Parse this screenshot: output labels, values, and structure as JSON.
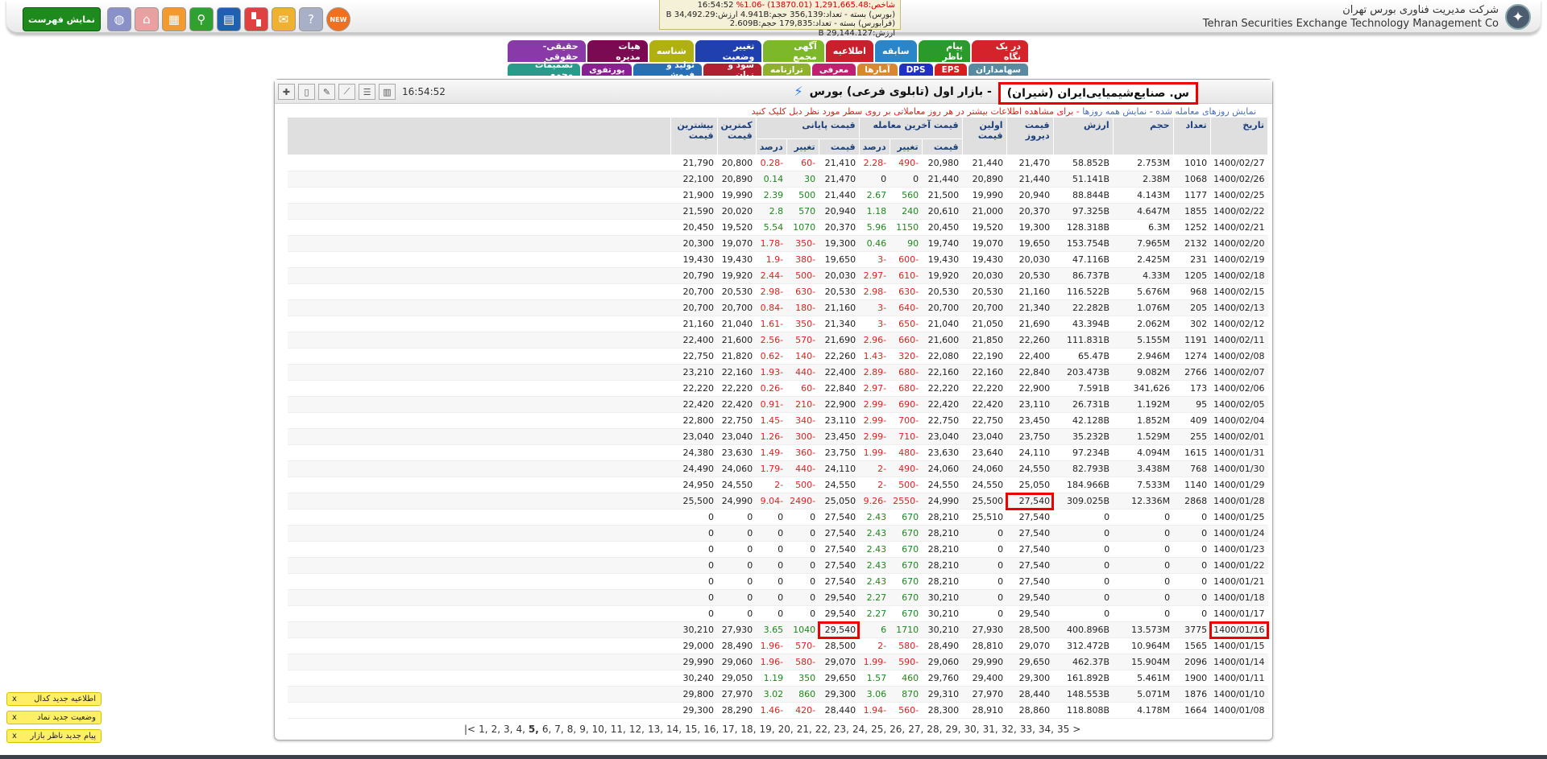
{
  "header": {
    "company_fa": "شرکت مدیریت فناوری بورس تهران",
    "company_en": "Tehran Securities Exchange Technology Management Co",
    "ticker_line1": "شاخص:1,291,665.48 (13870.01) -1.06%",
    "ticker_line1_time": "16:54:52",
    "ticker_line2": "(بورس) بسته - تعداد:356,139 حجم:4.941B ارزش:34,492.29 B",
    "ticker_line3": "(فرابورس) بسته - تعداد:179,835 حجم:2.609B ارزش:29,144.127 B",
    "show_list_label": "نمایش فهرست",
    "new_label": "NEW"
  },
  "tabs_row1": [
    {
      "label": "در یک نگاه",
      "color": "#d4232a"
    },
    {
      "label": "پیام ناظر",
      "color": "#2a9a2a"
    },
    {
      "label": "سابقه",
      "color": "#2a86c8"
    },
    {
      "label": "اطلاعیه",
      "color": "#c8202c"
    },
    {
      "label": "آگهی مجمع",
      "color": "#7cb82a"
    },
    {
      "label": "تغییر وضعیت",
      "color": "#2040b0"
    },
    {
      "label": "شناسه",
      "color": "#b0b010"
    },
    {
      "label": "هیات مدیره",
      "color": "#7a0a52"
    },
    {
      "label": "حقیقی-حقوقی",
      "color": "#8a3aa8"
    }
  ],
  "tabs_row2": [
    {
      "label": "سهامداران",
      "color": "#5a8aa0"
    },
    {
      "label": "EPS",
      "color": "#d42020"
    },
    {
      "label": "DPS",
      "color": "#2030c0"
    },
    {
      "label": "آمارها",
      "color": "#d88830"
    },
    {
      "label": "معرفی",
      "color": "#c02070"
    },
    {
      "label": "ترازنامه",
      "color": "#90b030"
    },
    {
      "label": "سود و زیان",
      "color": "#b02030"
    },
    {
      "label": "تولید و فروش",
      "color": "#2a70b0"
    },
    {
      "label": "پورتفوی",
      "color": "#8a2090"
    },
    {
      "label": "تصمیمات مجمع",
      "color": "#2a9a8a"
    }
  ],
  "panel": {
    "symbol_name": "س. صنایع‌شیمیایی‌ایران (شیران)",
    "market": "- بازار اول (تابلوی فرعی) بورس",
    "clock": "16:54:52",
    "sub_link": "نمایش روزهای معامله شده",
    "sub_sep": " - ",
    "sub_all": "نمایش همه روزها",
    "sub_hint": "- برای مشاهده اطلاعات بیشتر در هر روز معاملاتی بر روی سطر مورد نظر دبل کلیک کنید"
  },
  "table": {
    "headers": {
      "date": "تاریخ",
      "count": "تعداد",
      "volume": "حجم",
      "value": "ارزش",
      "yesterday": "قیمت دیروز",
      "first": "اولین قیمت",
      "last_group": "قیمت آخرین معامله",
      "close_group": "قیمت پایانی",
      "min": "کمترین قیمت",
      "max": "بیشترین قیمت",
      "price": "قیمت",
      "change": "تغییر",
      "percent": "درصد"
    },
    "rows": [
      [
        "1400/02/27",
        "1010",
        "2.753M",
        "58.852B",
        "21,470",
        "21,440",
        "20,980",
        "-490",
        "-2.28",
        "21,410",
        "-60",
        "-0.28",
        "20,800",
        "21,790"
      ],
      [
        "1400/02/26",
        "1068",
        "2.38M",
        "51.141B",
        "21,440",
        "20,890",
        "21,440",
        "0",
        "0",
        "21,470",
        "30",
        "0.14",
        "20,890",
        "22,100"
      ],
      [
        "1400/02/25",
        "1177",
        "4.143M",
        "88.844B",
        "20,940",
        "19,990",
        "21,500",
        "560",
        "2.67",
        "21,440",
        "500",
        "2.39",
        "19,990",
        "21,900"
      ],
      [
        "1400/02/22",
        "1855",
        "4.647M",
        "97.325B",
        "20,370",
        "21,000",
        "20,610",
        "240",
        "1.18",
        "20,940",
        "570",
        "2.8",
        "20,020",
        "21,590"
      ],
      [
        "1400/02/21",
        "1252",
        "6.3M",
        "128.318B",
        "19,300",
        "19,520",
        "20,450",
        "1150",
        "5.96",
        "20,370",
        "1070",
        "5.54",
        "19,520",
        "20,450"
      ],
      [
        "1400/02/20",
        "2132",
        "7.965M",
        "153.754B",
        "19,650",
        "19,070",
        "19,740",
        "90",
        "0.46",
        "19,300",
        "-350",
        "-1.78",
        "19,070",
        "20,300"
      ],
      [
        "1400/02/19",
        "231",
        "2.425M",
        "47.116B",
        "20,030",
        "19,430",
        "19,430",
        "-600",
        "-3",
        "19,650",
        "-380",
        "-1.9",
        "19,430",
        "19,430"
      ],
      [
        "1400/02/18",
        "1205",
        "4.33M",
        "86.737B",
        "20,530",
        "20,030",
        "19,920",
        "-610",
        "-2.97",
        "20,030",
        "-500",
        "-2.44",
        "19,920",
        "20,790"
      ],
      [
        "1400/02/15",
        "968",
        "5.676M",
        "116.522B",
        "21,160",
        "20,530",
        "20,530",
        "-630",
        "-2.98",
        "20,530",
        "-630",
        "-2.98",
        "20,530",
        "20,700"
      ],
      [
        "1400/02/13",
        "205",
        "1.076M",
        "22.282B",
        "21,340",
        "20,700",
        "20,700",
        "-640",
        "-3",
        "21,160",
        "-180",
        "-0.84",
        "20,700",
        "20,700"
      ],
      [
        "1400/02/12",
        "302",
        "2.062M",
        "43.394B",
        "21,690",
        "21,050",
        "21,040",
        "-650",
        "-3",
        "21,340",
        "-350",
        "-1.61",
        "21,040",
        "21,160"
      ],
      [
        "1400/02/11",
        "1191",
        "5.155M",
        "111.831B",
        "22,260",
        "21,850",
        "21,600",
        "-660",
        "-2.96",
        "21,690",
        "-570",
        "-2.56",
        "21,600",
        "22,400"
      ],
      [
        "1400/02/08",
        "1274",
        "2.946M",
        "65.47B",
        "22,400",
        "22,190",
        "22,080",
        "-320",
        "-1.43",
        "22,260",
        "-140",
        "-0.62",
        "21,820",
        "22,750"
      ],
      [
        "1400/02/07",
        "2766",
        "9.082M",
        "203.473B",
        "22,840",
        "22,160",
        "22,160",
        "-680",
        "-2.89",
        "22,400",
        "-440",
        "-1.93",
        "22,160",
        "23,210"
      ],
      [
        "1400/02/06",
        "173",
        "341,626",
        "7.591B",
        "22,900",
        "22,220",
        "22,220",
        "-680",
        "-2.97",
        "22,840",
        "-60",
        "-0.26",
        "22,220",
        "22,220"
      ],
      [
        "1400/02/05",
        "95",
        "1.192M",
        "26.731B",
        "23,110",
        "22,420",
        "22,420",
        "-690",
        "-2.99",
        "22,900",
        "-210",
        "-0.91",
        "22,420",
        "22,420"
      ],
      [
        "1400/02/04",
        "409",
        "1.852M",
        "42.128B",
        "23,450",
        "22,750",
        "22,750",
        "-700",
        "-2.99",
        "23,110",
        "-340",
        "-1.45",
        "22,750",
        "22,800"
      ],
      [
        "1400/02/01",
        "255",
        "1.529M",
        "35.232B",
        "23,750",
        "23,040",
        "23,040",
        "-710",
        "-2.99",
        "23,450",
        "-300",
        "-1.26",
        "23,040",
        "23,040"
      ],
      [
        "1400/01/31",
        "1615",
        "4.094M",
        "97.234B",
        "24,110",
        "23,640",
        "23,630",
        "-480",
        "-1.99",
        "23,750",
        "-360",
        "-1.49",
        "23,630",
        "24,380"
      ],
      [
        "1400/01/30",
        "768",
        "3.438M",
        "82.793B",
        "24,550",
        "24,060",
        "24,060",
        "-490",
        "-2",
        "24,110",
        "-440",
        "-1.79",
        "24,060",
        "24,490"
      ],
      [
        "1400/01/29",
        "1140",
        "7.533M",
        "184.966B",
        "25,050",
        "24,550",
        "24,550",
        "-500",
        "-2",
        "24,550",
        "-500",
        "-2",
        "24,550",
        "24,950"
      ],
      [
        "1400/01/28",
        "2868",
        "12.336M",
        "309.025B",
        "27,540",
        "25,500",
        "24,990",
        "-2550",
        "-9.26",
        "25,050",
        "-2490",
        "-9.04",
        "24,990",
        "25,500"
      ],
      [
        "1400/01/25",
        "0",
        "0",
        "0",
        "27,540",
        "25,510",
        "28,210",
        "670",
        "2.43",
        "27,540",
        "0",
        "0",
        "0",
        "0"
      ],
      [
        "1400/01/24",
        "0",
        "0",
        "0",
        "27,540",
        "0",
        "28,210",
        "670",
        "2.43",
        "27,540",
        "0",
        "0",
        "0",
        "0"
      ],
      [
        "1400/01/23",
        "0",
        "0",
        "0",
        "27,540",
        "0",
        "28,210",
        "670",
        "2.43",
        "27,540",
        "0",
        "0",
        "0",
        "0"
      ],
      [
        "1400/01/22",
        "0",
        "0",
        "0",
        "27,540",
        "0",
        "28,210",
        "670",
        "2.43",
        "27,540",
        "0",
        "0",
        "0",
        "0"
      ],
      [
        "1400/01/21",
        "0",
        "0",
        "0",
        "27,540",
        "0",
        "28,210",
        "670",
        "2.43",
        "27,540",
        "0",
        "0",
        "0",
        "0"
      ],
      [
        "1400/01/18",
        "0",
        "0",
        "0",
        "29,540",
        "0",
        "30,210",
        "670",
        "2.27",
        "29,540",
        "0",
        "0",
        "0",
        "0"
      ],
      [
        "1400/01/17",
        "0",
        "0",
        "0",
        "29,540",
        "0",
        "30,210",
        "670",
        "2.27",
        "29,540",
        "0",
        "0",
        "0",
        "0"
      ],
      [
        "1400/01/16",
        "3775",
        "13.573M",
        "400.896B",
        "28,500",
        "27,930",
        "30,210",
        "1710",
        "6",
        "29,540",
        "1040",
        "3.65",
        "27,930",
        "30,210"
      ],
      [
        "1400/01/15",
        "1565",
        "10.964M",
        "312.472B",
        "29,070",
        "28,810",
        "28,490",
        "-580",
        "-2",
        "28,500",
        "-570",
        "-1.96",
        "28,490",
        "29,000"
      ],
      [
        "1400/01/14",
        "2096",
        "15.904M",
        "462.37B",
        "29,650",
        "29,990",
        "29,060",
        "-590",
        "-1.99",
        "29,070",
        "-580",
        "-1.96",
        "29,060",
        "29,990"
      ],
      [
        "1400/01/11",
        "1900",
        "5.461M",
        "161.892B",
        "29,300",
        "29,400",
        "29,760",
        "460",
        "1.57",
        "29,650",
        "350",
        "1.19",
        "29,050",
        "30,240"
      ],
      [
        "1400/01/10",
        "1876",
        "5.071M",
        "148.553B",
        "28,440",
        "27,970",
        "29,310",
        "870",
        "3.06",
        "29,300",
        "860",
        "3.02",
        "27,970",
        "29,800"
      ],
      [
        "1400/01/08",
        "1664",
        "4.178M",
        "118.808B",
        "28,860",
        "28,910",
        "28,300",
        "-560",
        "-1.94",
        "28,440",
        "-420",
        "-1.46",
        "28,290",
        "29,300"
      ]
    ]
  },
  "pager": {
    "first": "|<",
    "pages": [
      "1",
      "2",
      "3",
      "4",
      "5",
      "6",
      "7",
      "8",
      "9",
      "10",
      "11",
      "12",
      "13",
      "14",
      "15",
      "16",
      "17",
      "18",
      "19",
      "20",
      "21",
      "22",
      "23",
      "24",
      "25",
      "26",
      "27",
      "28",
      "29",
      "30",
      "31",
      "32",
      "33",
      "34",
      "35"
    ],
    "current": "5",
    "next": ">"
  },
  "notifications": [
    {
      "text": "اطلاعیه جدید کدال",
      "close": "x"
    },
    {
      "text": "وضعیت جدید نماد",
      "close": "x"
    },
    {
      "text": "پیام جدید ناظر بازار",
      "close": "x"
    }
  ],
  "icons": [
    "new-badge-icon",
    "help-icon",
    "chat-icon",
    "grid-icon",
    "news-icon",
    "search-icon",
    "table-icon",
    "home-icon",
    "globe-icon"
  ]
}
